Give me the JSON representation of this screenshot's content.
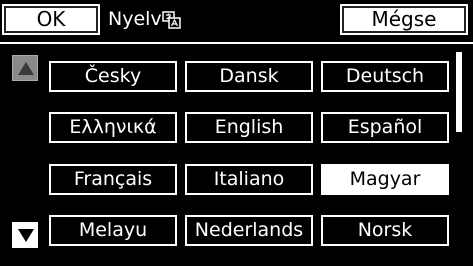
{
  "header": {
    "ok_label": "OK",
    "title": "Nyelv",
    "title_icon": "language-icon",
    "cancel_label": "Mégse"
  },
  "nav": {
    "up_icon": "arrow-up-icon",
    "down_icon": "arrow-down-icon"
  },
  "languages": [
    {
      "label": "Česky",
      "selected": false
    },
    {
      "label": "Dansk",
      "selected": false
    },
    {
      "label": "Deutsch",
      "selected": false
    },
    {
      "label": "Ελληνικά",
      "selected": false
    },
    {
      "label": "English",
      "selected": false
    },
    {
      "label": "Español",
      "selected": false
    },
    {
      "label": "Français",
      "selected": false
    },
    {
      "label": "Italiano",
      "selected": false
    },
    {
      "label": "Magyar",
      "selected": true
    },
    {
      "label": "Melayu",
      "selected": false
    },
    {
      "label": "Nederlands",
      "selected": false
    },
    {
      "label": "Norsk",
      "selected": false
    }
  ]
}
